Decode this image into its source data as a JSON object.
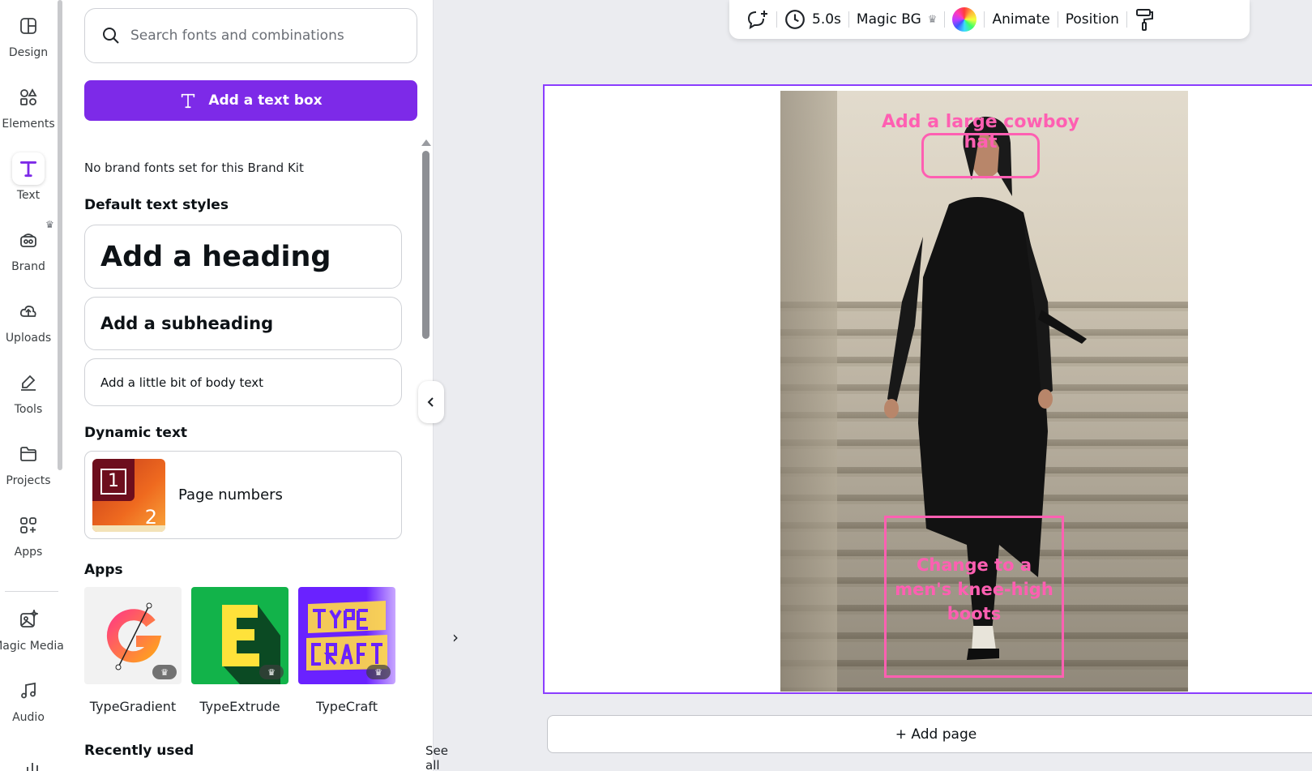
{
  "rail": {
    "items": [
      {
        "label": "Design",
        "icon": "layout-icon"
      },
      {
        "label": "Elements",
        "icon": "shapes-icon"
      },
      {
        "label": "Text",
        "icon": "text-icon"
      },
      {
        "label": "Brand",
        "icon": "brand-icon"
      },
      {
        "label": "Uploads",
        "icon": "cloud-upload-icon"
      },
      {
        "label": "Tools",
        "icon": "pen-icon"
      },
      {
        "label": "Projects",
        "icon": "folder-icon"
      },
      {
        "label": "Apps",
        "icon": "apps-grid-icon"
      },
      {
        "label": "Magic Media",
        "icon": "magic-image-icon"
      },
      {
        "label": "Audio",
        "icon": "music-note-icon"
      }
    ],
    "active": "Text"
  },
  "panel": {
    "search_placeholder": "Search fonts and combinations",
    "add_text_box": "Add a text box",
    "brand_note": "No brand fonts set for this Brand Kit",
    "default_styles_title": "Default text styles",
    "heading": "Add a heading",
    "subheading": "Add a subheading",
    "body": "Add a little bit of body text",
    "dynamic_title": "Dynamic text",
    "page_numbers": "Page numbers",
    "page_numbers_thumb": {
      "one": "1",
      "two": "2"
    },
    "apps_title": "Apps",
    "apps": [
      {
        "name": "TypeGradient"
      },
      {
        "name": "TypeExtrude"
      },
      {
        "name": "TypeCraft"
      }
    ],
    "recent_title": "Recently used",
    "see_all": "See all"
  },
  "toolbar": {
    "duration": "5.0s",
    "magic_bg": "Magic BG",
    "animate": "Animate",
    "position": "Position"
  },
  "canvas": {
    "annotation_hat": "Add a large cowboy hat",
    "annotation_boots": "Change to a men's knee-high boots"
  },
  "add_page": "+ Add page",
  "colors": {
    "accent": "#7d2ae8",
    "annotation": "#ff5fb2",
    "canvas_border": "#8b3dff"
  }
}
